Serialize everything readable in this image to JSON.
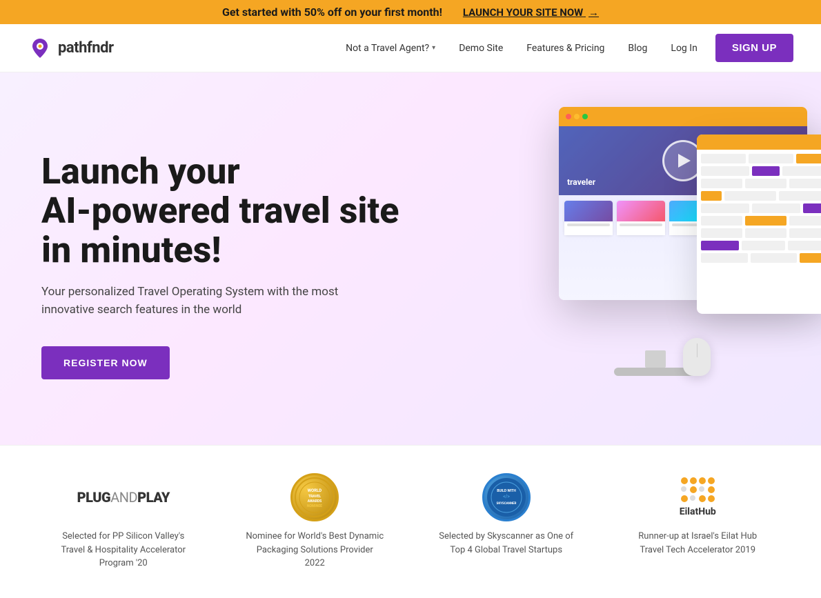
{
  "banner": {
    "text": "Get started with 50% off on your first month!",
    "cta": "LAUNCH YOUR SITE NOW",
    "arrow": "→"
  },
  "nav": {
    "logo_text": "pathfndr",
    "links": [
      {
        "id": "not-travel-agent",
        "label": "Not a Travel Agent?",
        "has_dropdown": true
      },
      {
        "id": "demo-site",
        "label": "Demo Site",
        "has_dropdown": false
      },
      {
        "id": "features-pricing",
        "label": "Features & Pricing",
        "has_dropdown": false
      },
      {
        "id": "blog",
        "label": "Blog",
        "has_dropdown": false
      }
    ],
    "login_label": "Log In",
    "signup_label": "SIGN UP"
  },
  "hero": {
    "title_line1": "Launch your",
    "title_line2": "AI-powered travel site",
    "title_line3": "in minutes!",
    "subtitle": "Your personalized Travel Operating System with the most innovative search features in the world",
    "cta_label": "REGISTER NOW"
  },
  "partners": [
    {
      "id": "plugandplay",
      "logo_type": "text",
      "logo_text": "PLUG",
      "logo_text2": "AND",
      "logo_text3": "PLAY",
      "description": "Selected for PP Silicon Valley's Travel & Hospitality Accelerator Program '20"
    },
    {
      "id": "world-travel",
      "logo_type": "badge-gold",
      "badge_text": "WORLD TRAVEL AWARDS NOMINEE",
      "description": "Nominee for World's Best Dynamic Packaging Solutions Provider 2022"
    },
    {
      "id": "skyscanner",
      "logo_type": "badge-blue",
      "badge_text": "BUILD WITH SKYSCANNER",
      "description": "Selected by Skyscanner as One of Top 4 Global Travel Startups"
    },
    {
      "id": "eilathub",
      "logo_type": "eilathub",
      "logo_name": "EilatHub",
      "description": "Runner-up at Israel's Eilat Hub Travel Tech Accelerator 2019"
    }
  ]
}
